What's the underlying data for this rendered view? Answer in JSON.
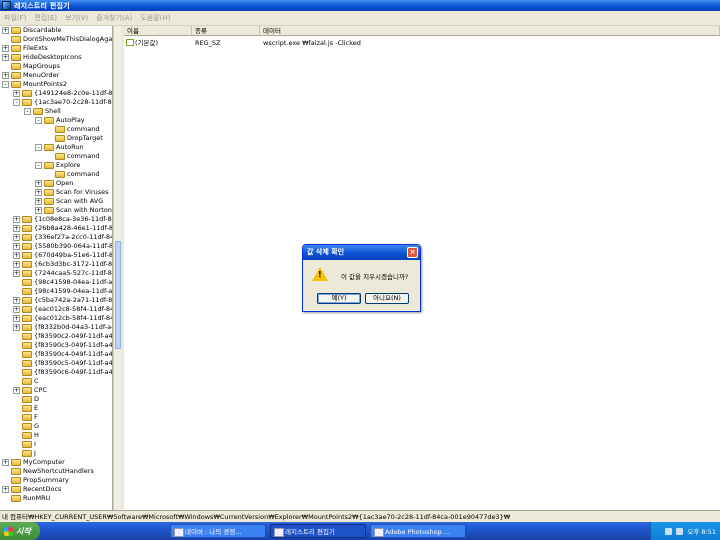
{
  "window": {
    "title": "레지스트리 편집기"
  },
  "menu": [
    "파일(F)",
    "편집(E)",
    "보기(V)",
    "즐겨찾기(A)",
    "도움말(H)"
  ],
  "tree": [
    {
      "label": "Discardable",
      "indent": 0,
      "exp": "+"
    },
    {
      "label": "DontShowMeThisDialogAga",
      "indent": 0,
      "exp": ""
    },
    {
      "label": "FileExts",
      "indent": 0,
      "exp": "+"
    },
    {
      "label": "HideDesktopIcons",
      "indent": 0,
      "exp": "+"
    },
    {
      "label": "MapGroups",
      "indent": 0,
      "exp": ""
    },
    {
      "label": "MenuOrder",
      "indent": 0,
      "exp": "+"
    },
    {
      "label": "MountPoints2",
      "indent": 0,
      "exp": "-"
    },
    {
      "label": "{149124e8-2c0e-11df-84c",
      "indent": 1,
      "exp": "+"
    },
    {
      "label": "{1ac3ae70-2c28-11df-84c",
      "indent": 1,
      "exp": "-"
    },
    {
      "label": "Shell",
      "indent": 2,
      "exp": "-"
    },
    {
      "label": "AutoPlay",
      "indent": 3,
      "exp": "-"
    },
    {
      "label": "command",
      "indent": 4,
      "exp": ""
    },
    {
      "label": "DropTarget",
      "indent": 4,
      "exp": ""
    },
    {
      "label": "AutoRun",
      "indent": 3,
      "exp": "-"
    },
    {
      "label": "command",
      "indent": 4,
      "exp": ""
    },
    {
      "label": "Explore",
      "indent": 3,
      "exp": "-"
    },
    {
      "label": "command",
      "indent": 4,
      "exp": "",
      "open": true
    },
    {
      "label": "Open",
      "indent": 3,
      "exp": "+"
    },
    {
      "label": "Scan for Viruses",
      "indent": 3,
      "exp": "+"
    },
    {
      "label": "Scan with AVG",
      "indent": 3,
      "exp": "+"
    },
    {
      "label": "Scan with Norton",
      "indent": 3,
      "exp": "+"
    },
    {
      "label": "{1c08e8ca-3e36-11df-84c",
      "indent": 1,
      "exp": "+"
    },
    {
      "label": "{26b8a428-46e1-11df-84c",
      "indent": 1,
      "exp": "+"
    },
    {
      "label": "{336ef27a-2cc0-11df-84c",
      "indent": 1,
      "exp": "+"
    },
    {
      "label": "{5580b390-064a-11df-84c",
      "indent": 1,
      "exp": "+"
    },
    {
      "label": "{670d49ba-51e6-11df-84",
      "indent": 1,
      "exp": "+"
    },
    {
      "label": "{6cb3d3bc-3172-11df-84",
      "indent": 1,
      "exp": "+"
    },
    {
      "label": "{7244caa5-527c-11df-84",
      "indent": 1,
      "exp": "+"
    },
    {
      "label": "{98c41598-04ea-11df-a7",
      "indent": 1,
      "exp": ""
    },
    {
      "label": "{98c41599-04ea-11df-a7",
      "indent": 1,
      "exp": ""
    },
    {
      "label": "{c5ba742a-2a71-11df-84",
      "indent": 1,
      "exp": "+"
    },
    {
      "label": "{eac012c8-58f4-11df-84",
      "indent": 1,
      "exp": "+"
    },
    {
      "label": "{eac012cb-58f4-11df-84",
      "indent": 1,
      "exp": "+"
    },
    {
      "label": "{f8332b0d-04a3-11df-a48",
      "indent": 1,
      "exp": "+"
    },
    {
      "label": "{f83590c2-049f-11df-a483",
      "indent": 1,
      "exp": ""
    },
    {
      "label": "{f83590c3-049f-11df-a483",
      "indent": 1,
      "exp": ""
    },
    {
      "label": "{f83590c4-049f-11df-a483",
      "indent": 1,
      "exp": ""
    },
    {
      "label": "{f83590c5-049f-11df-a483",
      "indent": 1,
      "exp": ""
    },
    {
      "label": "{f83590c6-049f-11df-a483",
      "indent": 1,
      "exp": ""
    },
    {
      "label": "C",
      "indent": 1,
      "exp": ""
    },
    {
      "label": "CPC",
      "indent": 1,
      "exp": "+"
    },
    {
      "label": "D",
      "indent": 1,
      "exp": ""
    },
    {
      "label": "E",
      "indent": 1,
      "exp": ""
    },
    {
      "label": "F",
      "indent": 1,
      "exp": ""
    },
    {
      "label": "G",
      "indent": 1,
      "exp": ""
    },
    {
      "label": "H",
      "indent": 1,
      "exp": ""
    },
    {
      "label": "I",
      "indent": 1,
      "exp": ""
    },
    {
      "label": "J",
      "indent": 1,
      "exp": ""
    },
    {
      "label": "MyComputer",
      "indent": 0,
      "exp": "+"
    },
    {
      "label": "NewShortcutHandlers",
      "indent": 0,
      "exp": ""
    },
    {
      "label": "PropSummary",
      "indent": 0,
      "exp": ""
    },
    {
      "label": "RecentDocs",
      "indent": 0,
      "exp": "+"
    },
    {
      "label": "RunMRU",
      "indent": 0,
      "exp": ""
    }
  ],
  "list": {
    "headers": [
      "이름",
      "종류",
      "데이터"
    ],
    "row": {
      "name": "(기본값)",
      "type": "REG_SZ",
      "data": "wscript.exe ₩faizal.js -Clicked"
    }
  },
  "status": "내 컴퓨터₩HKEY_CURRENT_USER₩Software₩Microsoft₩Windows₩CurrentVersion₩Explorer₩MountPoints2₩{1ac3ae70-2c28-11df-84ca-001e90477de3}₩",
  "dialog": {
    "title": "값 삭제 확인",
    "message": "이 값을 지우시겠습니까?",
    "yes": "예(Y)",
    "no": "아니요(N)",
    "close": "×",
    "warn_glyph": "!"
  },
  "taskbar": {
    "start": "시작",
    "items": [
      "네이버 : 나의 경쟁...",
      "레지스트리 편집기",
      "Adobe Photoshop ..."
    ],
    "clock": "오후 8:51"
  }
}
